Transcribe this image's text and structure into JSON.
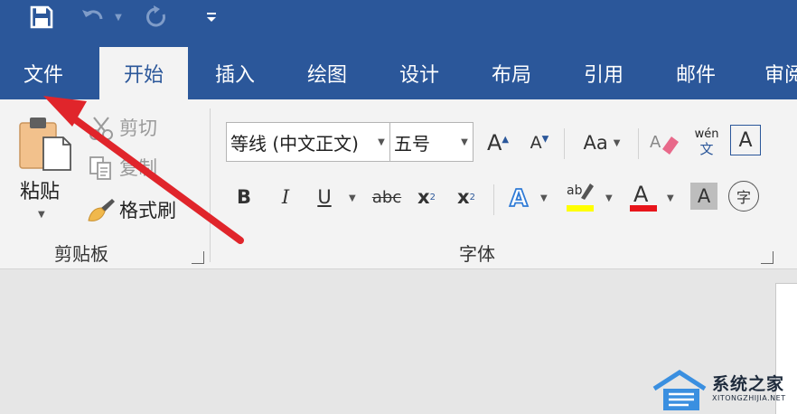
{
  "tabs": [
    {
      "label": "文件"
    },
    {
      "label": "开始"
    },
    {
      "label": "插入"
    },
    {
      "label": "绘图"
    },
    {
      "label": "设计"
    },
    {
      "label": "布局"
    },
    {
      "label": "引用"
    },
    {
      "label": "邮件"
    },
    {
      "label": "审阅"
    }
  ],
  "clipboard": {
    "paste_label": "粘贴",
    "cut_label": "剪切",
    "copy_label": "复制",
    "format_painter_label": "格式刷",
    "group_label": "剪贴板"
  },
  "font": {
    "font_name": "等线 (中文正文)",
    "font_size": "五号",
    "group_label": "字体",
    "change_case_label": "Aa",
    "phonetic_top": "wén",
    "phonetic_bottom": "文",
    "bold": "B",
    "italic": "I",
    "underline": "U",
    "strikethrough": "abc",
    "subscript_base": "x",
    "subscript_mark": "2",
    "superscript_base": "x",
    "superscript_mark": "2",
    "enclose_char": "字"
  },
  "watermark": {
    "name": "系统之家",
    "url": "XITONGZHIJIA.NET"
  },
  "colors": {
    "title_bar": "#2b579a",
    "ribbon": "#f3f3f3",
    "highlight": "#ffff00",
    "font_color": "#ff0000",
    "arrow": "#e0252b"
  }
}
